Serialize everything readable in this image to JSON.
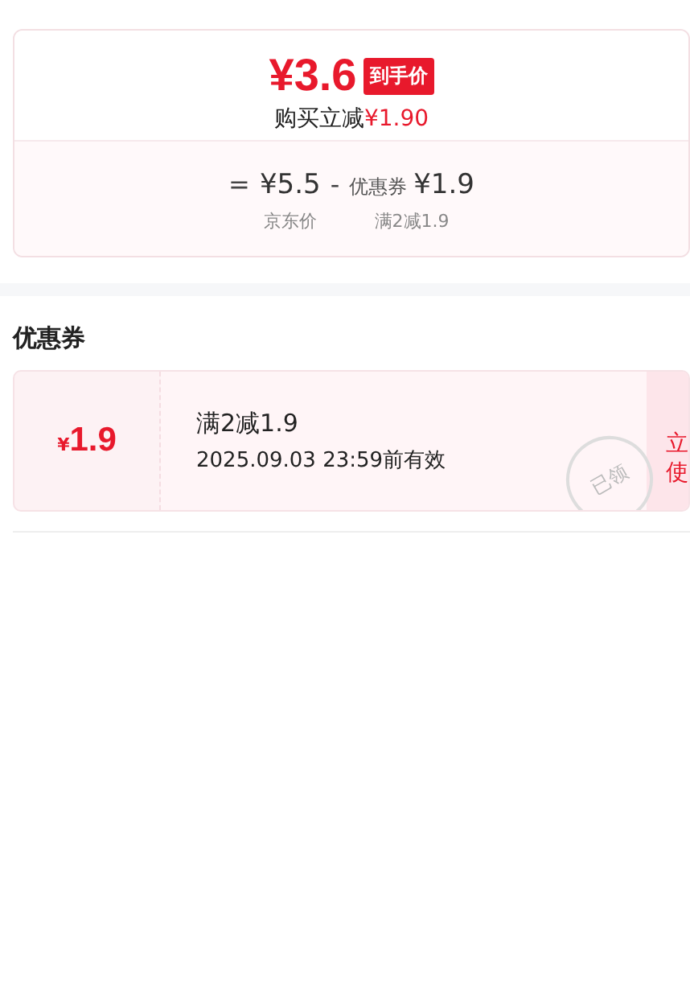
{
  "price_card": {
    "final_price": "¥3.6",
    "final_badge": "到手价",
    "saving_label": "购买立减",
    "saving_amount": "¥1.90",
    "formula": [
      {
        "kind": "op",
        "value": "="
      },
      {
        "kind": "price",
        "value": "¥5.5",
        "caption": "京东价"
      },
      {
        "kind": "op",
        "value": "-"
      },
      {
        "kind": "discount",
        "label": "优惠券",
        "value": "¥1.9",
        "caption": "满2减1.9"
      }
    ]
  },
  "coupons_section": {
    "title": "优惠券",
    "coupons": [
      {
        "amount_symbol": "¥",
        "amount": "1.9",
        "condition": "满2减1.9",
        "validity": "2025.09.03 23:59前有效",
        "stamp": "已领",
        "claimed": true,
        "action": "立使"
      }
    ]
  }
}
